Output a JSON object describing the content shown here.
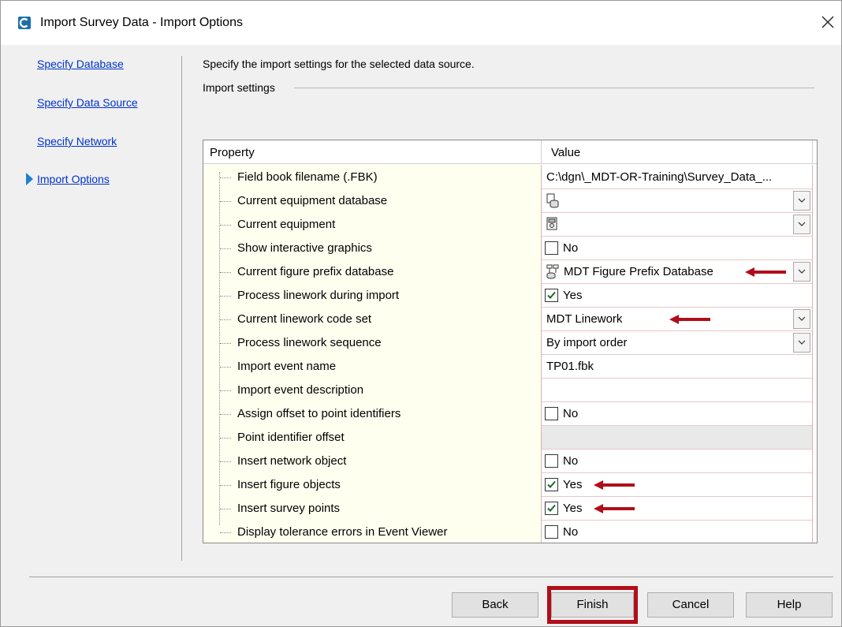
{
  "dialog": {
    "title": "Import Survey Data - Import Options",
    "close_glyph": "✕",
    "app_icon": "civil3d-app-icon"
  },
  "nav": {
    "items": [
      {
        "label": "Specify Database"
      },
      {
        "label": "Specify Data Source"
      },
      {
        "label": "Specify Network"
      },
      {
        "label": "Import Options"
      }
    ],
    "current": "Import Options"
  },
  "content": {
    "instruction": "Specify the import settings for the selected data source.",
    "group_label": "Import settings"
  },
  "grid": {
    "headers": {
      "property": "Property",
      "value": "Value"
    },
    "rows": [
      {
        "property": "Field book filename (.FBK)",
        "value": "C:\\dgn\\_MDT-OR-Training\\Survey_Data_..."
      },
      {
        "property": "Current equipment database",
        "value": ""
      },
      {
        "property": "Current equipment",
        "value": ""
      },
      {
        "property": "Show interactive graphics",
        "value": "No",
        "checked": false
      },
      {
        "property": "Current figure prefix database",
        "value": "MDT Figure Prefix Database"
      },
      {
        "property": "Process linework during import",
        "value": "Yes",
        "checked": true
      },
      {
        "property": "Current linework code set",
        "value": "MDT Linework"
      },
      {
        "property": "Process linework sequence",
        "value": "By import order"
      },
      {
        "property": "Import event name",
        "value": "TP01.fbk"
      },
      {
        "property": "Import event description",
        "value": ""
      },
      {
        "property": "Assign offset to point identifiers",
        "value": "No",
        "checked": false
      },
      {
        "property": "Point identifier offset",
        "value": ""
      },
      {
        "property": "Insert network object",
        "value": "No",
        "checked": false
      },
      {
        "property": "Insert figure objects",
        "value": "Yes",
        "checked": true
      },
      {
        "property": "Insert survey points",
        "value": "Yes",
        "checked": true
      },
      {
        "property": "Display tolerance errors in Event Viewer",
        "value": "No",
        "checked": false
      }
    ]
  },
  "footer": {
    "back": "Back",
    "finish": "Finish",
    "cancel": "Cancel",
    "help": "Help"
  },
  "colors": {
    "link": "#0033cc",
    "annotation_red": "#b00f1a",
    "property_bg": "#fffff0"
  }
}
